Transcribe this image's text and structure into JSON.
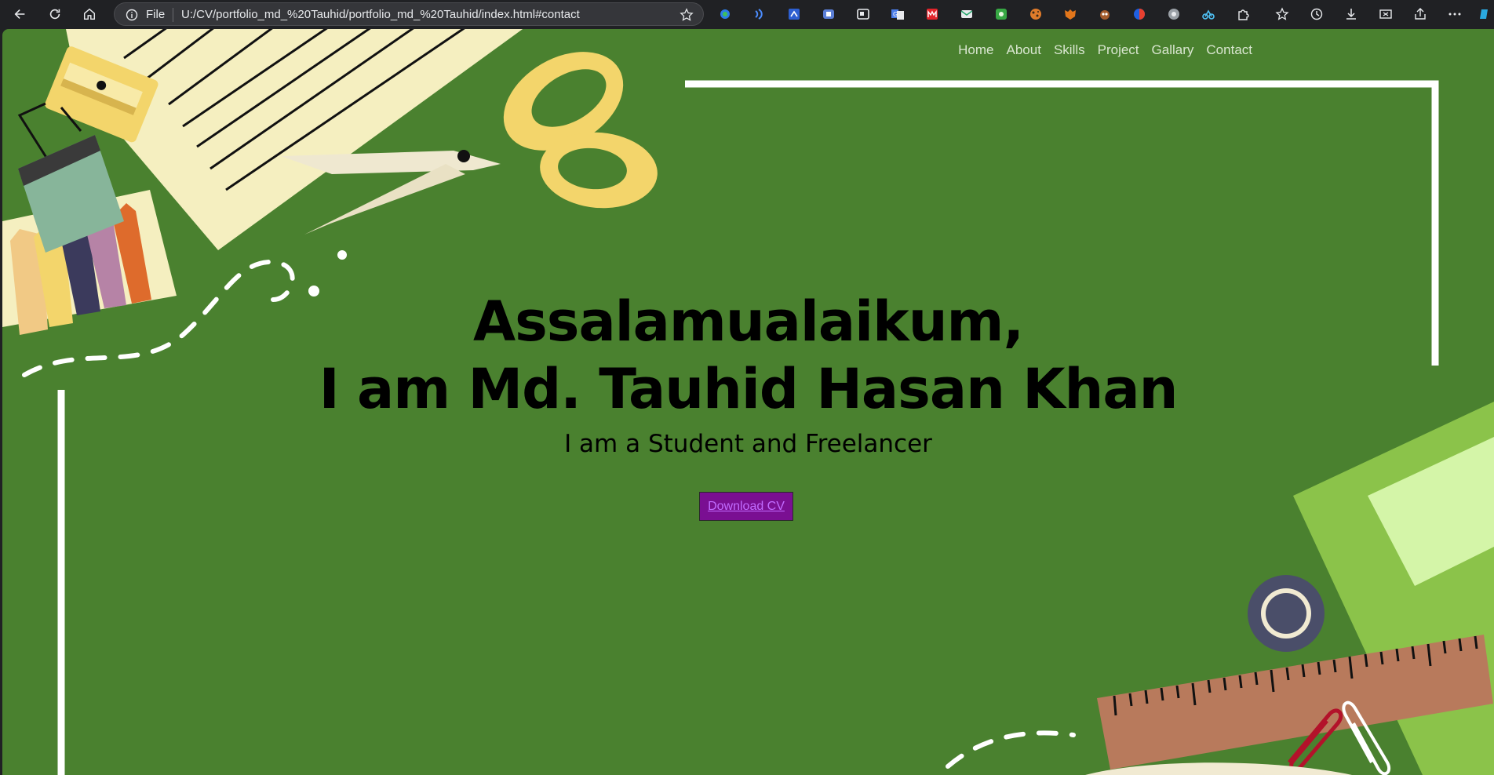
{
  "browser": {
    "scheme_label": "File",
    "url": "U:/CV/portfolio_md_%20Tauhid/portfolio_md_%20Tauhid/index.html#contact",
    "nav_icons": [
      "back-icon",
      "reload-icon",
      "home-icon"
    ],
    "toolbar_icons": [
      "favorites-star-icon",
      "history-icon",
      "download-icon",
      "screenshot-icon",
      "share-icon",
      "more-menu-icon"
    ],
    "extension_icons": [
      "extension-1-icon",
      "extension-2-icon",
      "extension-3-icon",
      "extension-4-icon",
      "extension-5-icon",
      "extension-6-icon",
      "extension-7-icon",
      "extension-8-icon",
      "extension-9-icon",
      "extension-10-icon",
      "extension-11-icon",
      "extension-12-icon",
      "extension-13-icon",
      "extension-14-icon",
      "extensions-puzzle-icon"
    ]
  },
  "nav": {
    "items": [
      {
        "label": "Home"
      },
      {
        "label": "About"
      },
      {
        "label": "Skills"
      },
      {
        "label": "Project"
      },
      {
        "label": "Gallary"
      },
      {
        "label": "Contact"
      }
    ]
  },
  "hero": {
    "greeting": "Assalamualaikum,",
    "name": "I am Md. Tauhid Hasan Khan",
    "role": "I am a Student and Freelancer",
    "cv_button": "Download CV"
  },
  "colors": {
    "background": "#4a812f",
    "button": "#7a0f92",
    "nav_text": "#d9e6d0"
  }
}
